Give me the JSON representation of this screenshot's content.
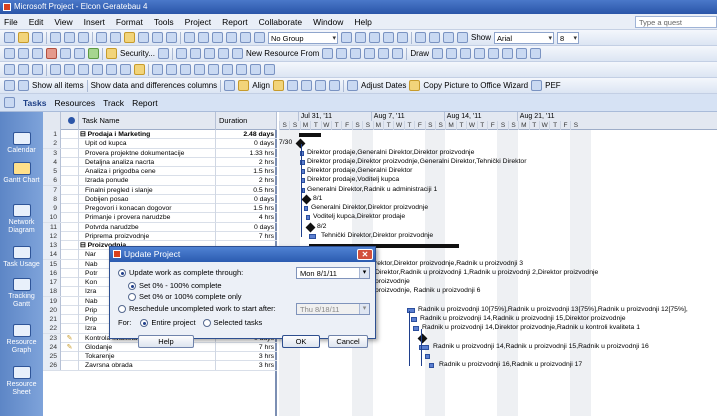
{
  "window": {
    "title": "Microsoft Project - Elcon Geratebau 4"
  },
  "menu": {
    "items": [
      "File",
      "Edit",
      "View",
      "Insert",
      "Format",
      "Tools",
      "Project",
      "Report",
      "Collaborate",
      "Window",
      "Help"
    ],
    "help_placeholder": "Type a quest"
  },
  "toolbar1": {
    "group_value": "No Group",
    "font_value": "Arial",
    "size_value": "8",
    "show_label": "Show"
  },
  "toolbar2": {
    "security_label": "Security...",
    "new_resource_label": "New Resource From",
    "draw_label": "Draw"
  },
  "toolbar3": {
    "placeholder": ""
  },
  "toolbar4": {
    "show_label": "Show all items",
    "diff_label": "Show data and differences columns",
    "align_label": "Align",
    "adjust_dates_label": "Adjust Dates",
    "copy_picture_label": "Copy Picture to Office Wizard",
    "pe_label": "PEF"
  },
  "viewbar": {
    "items": [
      "Tasks",
      "Resources",
      "Track",
      "Report"
    ]
  },
  "sidebar": {
    "items": [
      "Calendar",
      "Gantt Chart",
      "Network Diagram",
      "Task Usage",
      "Tracking Gantt",
      "Resource Graph",
      "Resource Sheet"
    ]
  },
  "grid": {
    "headers": {
      "id": "",
      "indicator": "",
      "name": "Task Name",
      "duration": "Duration"
    },
    "rows": [
      {
        "id": "1",
        "name": "Prodaja i Marketing",
        "duration": "2.48 days",
        "summary": true
      },
      {
        "id": "2",
        "name": "Upit od kupca",
        "duration": "0 days"
      },
      {
        "id": "3",
        "name": "Provera projektne dokumentacije",
        "duration": "1.33 hrs"
      },
      {
        "id": "4",
        "name": "Detaljna analiza nacrta",
        "duration": "2 hrs"
      },
      {
        "id": "5",
        "name": "Analiza i prigodba cene",
        "duration": "1.5 hrs"
      },
      {
        "id": "6",
        "name": "Izrada ponude",
        "duration": "2 hrs"
      },
      {
        "id": "7",
        "name": "Finalni pregled i slanje",
        "duration": "0.5 hrs"
      },
      {
        "id": "8",
        "name": "Dobijen posao",
        "duration": "0 days"
      },
      {
        "id": "9",
        "name": "Pregovori i konacan dogovor",
        "duration": "1.5 hrs"
      },
      {
        "id": "10",
        "name": "Primanje i provera narudzbe",
        "duration": "4 hrs"
      },
      {
        "id": "11",
        "name": "Potvrda narudzbe",
        "duration": "0 days"
      },
      {
        "id": "12",
        "name": "Priprema proizvodnje",
        "duration": "7 hrs"
      },
      {
        "id": "13",
        "name": "Proizvodnja",
        "duration": "",
        "summary": true
      },
      {
        "id": "14",
        "name": "Nar",
        "duration": ""
      },
      {
        "id": "15",
        "name": "Nab",
        "duration": ""
      },
      {
        "id": "16",
        "name": "Potr",
        "duration": ""
      },
      {
        "id": "17",
        "name": "Kon",
        "duration": ""
      },
      {
        "id": "18",
        "name": "Izra",
        "duration": ""
      },
      {
        "id": "19",
        "name": "Nab",
        "duration": ""
      },
      {
        "id": "20",
        "name": "Prip",
        "duration": ""
      },
      {
        "id": "21",
        "name": "Prip",
        "duration": ""
      },
      {
        "id": "22",
        "name": "Izra",
        "duration": ""
      },
      {
        "id": "23",
        "name": "Kontrola kvaliteta",
        "duration": "0 days",
        "note": true
      },
      {
        "id": "24",
        "name": "Glodanje",
        "duration": "7 hrs",
        "note": true
      },
      {
        "id": "25",
        "name": "Tokarenje",
        "duration": "3 hrs"
      },
      {
        "id": "26",
        "name": "Zavrsna obrada",
        "duration": "3 hrs"
      }
    ]
  },
  "timescale": {
    "weeks": [
      "Jul 31, '11",
      "Aug 7, '11",
      "Aug 14, '11",
      "Aug 21, '11"
    ],
    "days": [
      "S",
      "S",
      "M",
      "T",
      "W",
      "T",
      "F",
      "S",
      "S",
      "M",
      "T",
      "W",
      "T",
      "F",
      "S",
      "S",
      "M",
      "T",
      "W",
      "T",
      "F",
      "S",
      "S",
      "M",
      "T",
      "W",
      "T",
      "F",
      "S"
    ]
  },
  "gantt_labels": {
    "r2": "7/30",
    "r3": "Direktor prodaje,Generalni Direktor,Direktor proizvodnje",
    "r4": "Direktor prodaje,Direktor proizvodnje,Generalni Direktor,Tehnički Direktor",
    "r5": "Direktor prodaje,Generalni Direktor",
    "r6": "Direktor prodaje,Voditelj kupca",
    "r7": "Generalni Direktor,Radnik u administraciji 1",
    "r8": "8/1",
    "r9": "Generalni Direktor,Direktor proizvodnje",
    "r10": "Voditelj kupca,Direktor prodaje",
    "r11": "8/2",
    "r12": "Tehnički Direktor,Direktor proizvodnje",
    "r15": "rektor,Direktor proizvodnje,Radnik u proizvodnji 3",
    "r16": "Direktor,Radnik u proizvodnji 1,Radnik u proizvodnji 2,Direktor proizvodnje",
    "r17": "proizvodnje",
    "r18": "proizvodnje, Radnik u proizvodnji 6",
    "r20": "Radnik u proizvodnji 10[75%],Radnik u proizvodnji 13[75%],Radnik u proizvodnji 12[75%],",
    "r21": "Radnik u proizvodnji 14,Radnik u proizvodnji 15,Direktor proizvodnje",
    "r22": "Radnik u proizvodnji 14,Direktor proizvodnje,Radnik u kontroli kvaliteta 1",
    "r24": "Radnik u proizvodnji 14,Radnik u proizvodnji 15,Radnik u proizvodnji 16",
    "r26": "Radnik u proizvodnji 16,Radnik u proizvodnji 17"
  },
  "dialog": {
    "title": "Update Project",
    "opt_update": "Update work as complete through:",
    "date_value": "Mon 8/1/11",
    "opt_set_any": "Set 0% - 100% complete",
    "opt_set_binary": "Set 0% or 100% complete only",
    "opt_reschedule": "Reschedule uncompleted work to start after:",
    "reschedule_date": "Thu 8/18/11",
    "for_label": "For:",
    "opt_entire": "Entire project",
    "opt_selected": "Selected tasks",
    "help_btn": "Help",
    "ok_btn": "OK",
    "cancel_btn": "Cancel"
  }
}
